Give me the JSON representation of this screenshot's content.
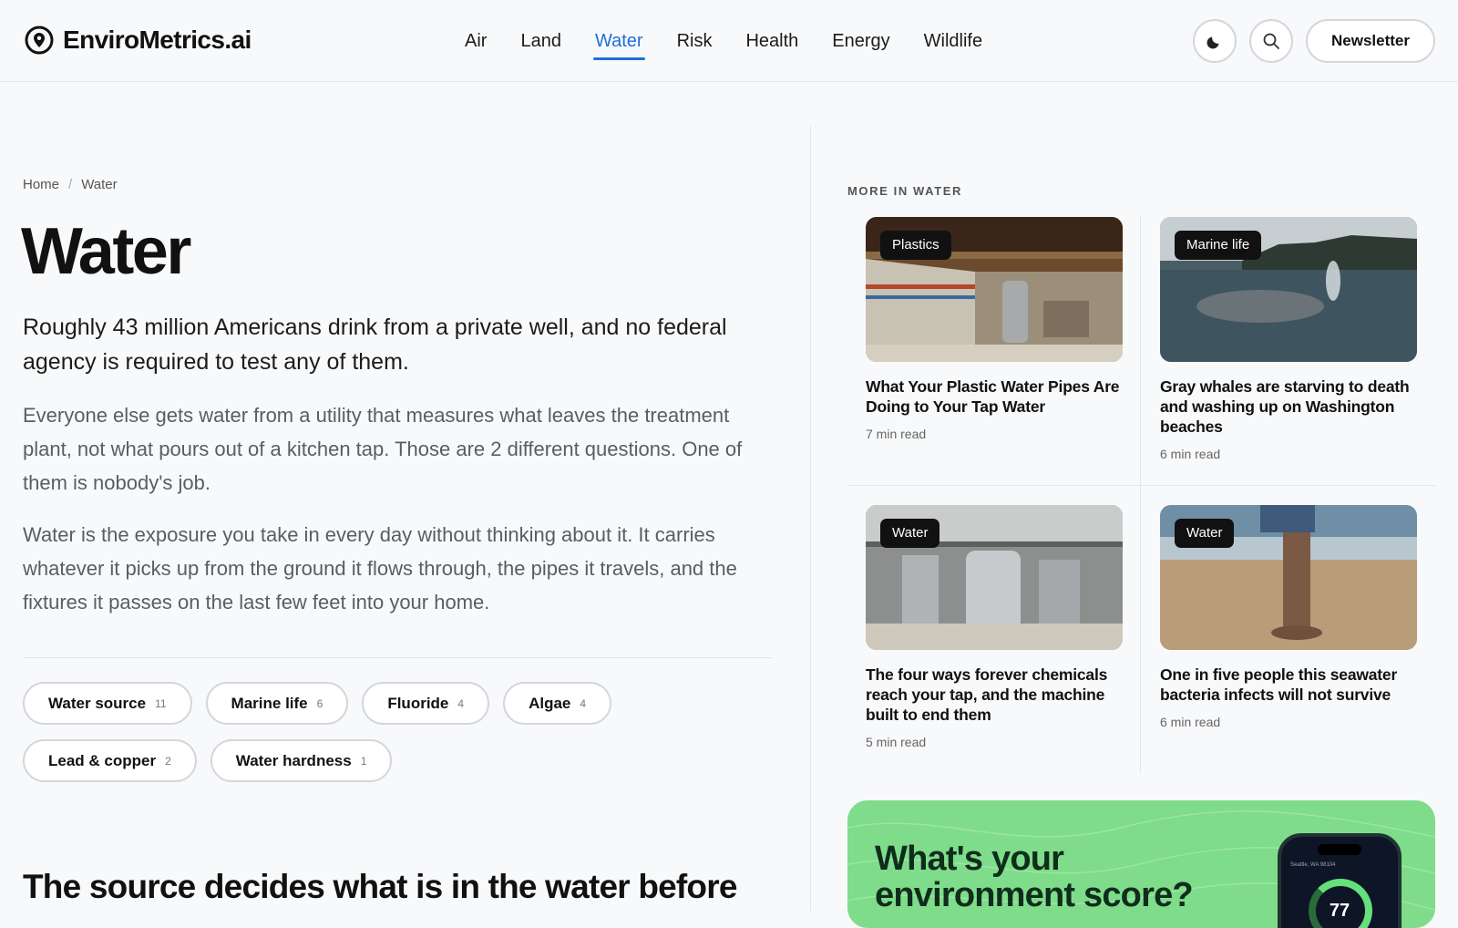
{
  "site": {
    "name": "EnviroMetrics.ai"
  },
  "nav": {
    "items": [
      {
        "label": "Air"
      },
      {
        "label": "Land"
      },
      {
        "label": "Water",
        "active": true
      },
      {
        "label": "Risk"
      },
      {
        "label": "Health"
      },
      {
        "label": "Energy"
      },
      {
        "label": "Wildlife"
      }
    ],
    "newsletter_label": "Newsletter",
    "theme_icon": "moon-icon",
    "search_icon": "search-icon"
  },
  "breadcrumb": {
    "home": "Home",
    "separator": "/",
    "current": "Water"
  },
  "page": {
    "title": "Water",
    "lead": "Roughly 43 million Americans drink from a private well, and no federal agency is required to test any of them.",
    "para1": "Everyone else gets water from a utility that measures what leaves the treatment plant, not what pours out of a kitchen tap. Those are 2 different questions. One of them is nobody's job.",
    "para2": "Water is the exposure you take in every day without thinking about it. It carries whatever it picks up from the ground it flows through, the pipes it travels, and the fixtures it passes on the last few feet into your home.",
    "section_heading": "The source decides what is in the water before"
  },
  "tags": [
    {
      "label": "Water source",
      "count": "11"
    },
    {
      "label": "Marine life",
      "count": "6"
    },
    {
      "label": "Fluoride",
      "count": "4"
    },
    {
      "label": "Algae",
      "count": "4"
    },
    {
      "label": "Lead & copper",
      "count": "2"
    },
    {
      "label": "Water hardness",
      "count": "1"
    }
  ],
  "more": {
    "label": "MORE IN WATER",
    "cards": [
      {
        "badge": "Plastics",
        "title": "What Your Plastic Water Pipes Are Doing to Your Tap Water",
        "meta": "7 min read"
      },
      {
        "badge": "Marine life",
        "title": "Gray whales are starving to death and washing up on Washington beaches",
        "meta": "6 min read"
      },
      {
        "badge": "Water",
        "title": "The four ways forever chemicals reach your tap, and the machine built to end them",
        "meta": "5 min read"
      },
      {
        "badge": "Water",
        "title": "One in five people this seawater bacteria infects will not survive",
        "meta": "6 min read"
      }
    ]
  },
  "promo": {
    "title": "What's your environment score?",
    "phone_location": "Seattle, WA 98104",
    "score": "77"
  },
  "colors": {
    "accent": "#1f6fd6",
    "promo_bg": "#7fdc8a"
  }
}
